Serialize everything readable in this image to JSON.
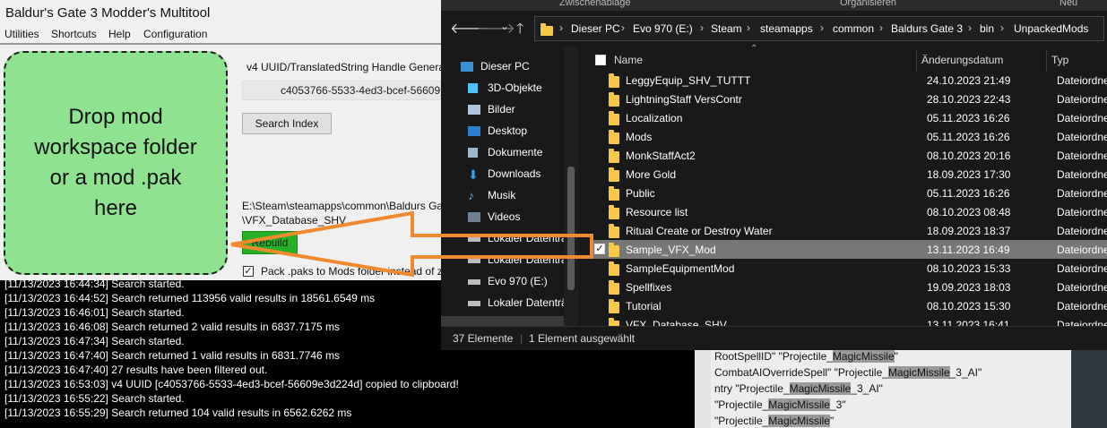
{
  "multitool": {
    "title": "Baldur's Gate 3 Modder's Multitool",
    "menu": [
      "Utilities",
      "Shortcuts",
      "Help",
      "Configuration"
    ],
    "dropzone_text": "Drop mod workspace folder or a mod .pak here",
    "uuid_label": "v4 UUID/TranslatedString Handle Genera",
    "uuid_value": "c4053766-5533-4ed3-bcef-56609",
    "search_index_label": "Search Index",
    "path_line1": "E:\\Steam\\steamapps\\common\\Baldurs Ga",
    "path_line2": "\\VFX_Database_SHV",
    "rebuild_label": "Rebuild",
    "pack_label": "Pack .paks to Mods folder instead of z",
    "pack_checked": true
  },
  "console": {
    "lines": [
      "[11/13/2023 16:44:34] Search started.",
      "[11/13/2023 16:44:52] Search returned 113956 valid results in 18561.6549 ms",
      "[11/13/2023 16:46:01] Search started.",
      "[11/13/2023 16:46:08] Search returned 2 valid results in 6837.7175 ms",
      "[11/13/2023 16:47:34] Search started.",
      "[11/13/2023 16:47:40] Search returned 1 valid results in 6831.7746 ms",
      "[11/13/2023 16:47:40] 27 results have been filtered out.",
      "[11/13/2023 16:53:03] v4 UUID [c4053766-5533-4ed3-bcef-56609e3d224d] copied to clipboard!",
      "[11/13/2023 16:55:22] Search started.",
      "[11/13/2023 16:55:29] Search returned 104 valid results in 6562.6262 ms"
    ]
  },
  "results": {
    "lines": [
      {
        "pre": "RootSpellID\" \"Projectile_",
        "hl": "MagicMissile",
        "post": "\""
      },
      {
        "pre": "CombatAIOverrideSpell\" \"Projectile_",
        "hl": "MagicMissile",
        "post": "_3_AI\""
      },
      {
        "pre": "ntry \"Projectile_",
        "hl": "MagicMissile",
        "post": "_3_AI\""
      },
      {
        "pre": "\"Projectile_",
        "hl": "MagicMissile",
        "post": "_3\""
      },
      {
        "pre": "\"Projectile_",
        "hl": "MagicMissile",
        "post": "\""
      }
    ]
  },
  "explorer": {
    "ribbon": [
      "Zwischenablage",
      "Organisieren",
      "Neu"
    ],
    "breadcrumb": [
      "Dieser PC",
      "Evo 970 (E:)",
      "Steam",
      "steamapps",
      "common",
      "Baldurs Gate 3",
      "bin",
      "UnpackedMods"
    ],
    "sidebar": [
      {
        "label": "Dieser PC",
        "icon": "pc-icon"
      },
      {
        "label": "3D-Objekte",
        "icon": "cube-icon"
      },
      {
        "label": "Bilder",
        "icon": "pictures-icon"
      },
      {
        "label": "Desktop",
        "icon": "desktop-icon"
      },
      {
        "label": "Dokumente",
        "icon": "documents-icon"
      },
      {
        "label": "Downloads",
        "icon": "download-icon"
      },
      {
        "label": "Musik",
        "icon": "music-icon"
      },
      {
        "label": "Videos",
        "icon": "video-icon"
      },
      {
        "label": "Lokaler Datenträ",
        "icon": "drive-icon"
      },
      {
        "label": "Lokaler Datenträ",
        "icon": "drive-icon"
      },
      {
        "label": "Evo 970 (E:)",
        "icon": "drive-icon"
      },
      {
        "label": "Lokaler Datenträ",
        "icon": "drive-icon"
      }
    ],
    "columns": {
      "name": "Name",
      "date": "Änderungsdatum",
      "type": "Typ"
    },
    "rows": [
      {
        "name": "LeggyEquip_SHV_TUTTT",
        "date": "24.10.2023 21:49",
        "type": "Dateiordner"
      },
      {
        "name": "LightningStaff VersContr",
        "date": "28.10.2023 22:43",
        "type": "Dateiordner"
      },
      {
        "name": "Localization",
        "date": "05.11.2023 16:26",
        "type": "Dateiordner"
      },
      {
        "name": "Mods",
        "date": "05.11.2023 16:26",
        "type": "Dateiordner"
      },
      {
        "name": "MonkStaffAct2",
        "date": "08.10.2023 20:16",
        "type": "Dateiordner"
      },
      {
        "name": "More Gold",
        "date": "18.09.2023 17:30",
        "type": "Dateiordner"
      },
      {
        "name": "Public",
        "date": "05.11.2023 16:26",
        "type": "Dateiordner"
      },
      {
        "name": "Resource list",
        "date": "08.10.2023 08:48",
        "type": "Dateiordner"
      },
      {
        "name": "Ritual Create or Destroy Water",
        "date": "18.09.2023 18:37",
        "type": "Dateiordner"
      },
      {
        "name": "Sample_VFX_Mod",
        "date": "13.11.2023 16:49",
        "type": "Dateiordner",
        "selected": true
      },
      {
        "name": "SampleEquipmentMod",
        "date": "08.10.2023 15:33",
        "type": "Dateiordner"
      },
      {
        "name": "Spellfixes",
        "date": "19.09.2023 18:03",
        "type": "Dateiordner"
      },
      {
        "name": "Tutorial",
        "date": "08.10.2023 15:30",
        "type": "Dateiordner"
      },
      {
        "name": "VFX_Database_SHV",
        "date": "13.11.2023 16:41",
        "type": "Dateiordner"
      }
    ],
    "status_count": "37 Elemente",
    "status_selected": "1 Element ausgewählt"
  },
  "colors": {
    "dropzone": "#8fe28f",
    "rebuild": "#27b027",
    "arrow": "#f08a30",
    "explorer_bg": "#191919",
    "selected_row": "#777777"
  }
}
